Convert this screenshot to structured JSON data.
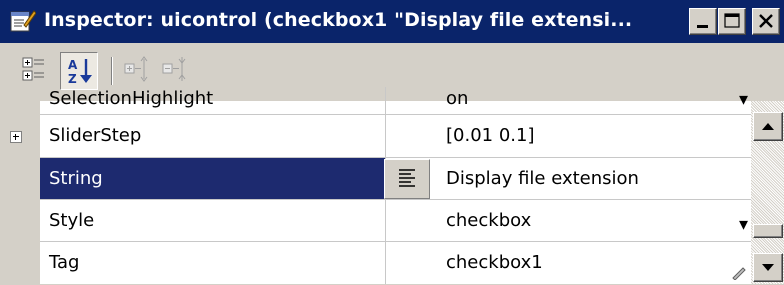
{
  "window": {
    "title": "Inspector:  uicontrol (checkbox1 \"Display file extensi...",
    "title_bg": "#0a246a"
  },
  "toolbar": {
    "buttons": [
      "categorized-view-icon",
      "alphabetical-sort-icon",
      "expand-all-icon",
      "collapse-all-icon"
    ]
  },
  "properties": {
    "rows": [
      {
        "name": "SelectionHighlight",
        "value": "on"
      },
      {
        "name": "SliderStep",
        "value": "[0.01 0.1]"
      },
      {
        "name": "String",
        "value": "Display file extension"
      },
      {
        "name": "Style",
        "value": "checkbox"
      },
      {
        "name": "Tag",
        "value": "checkbox1"
      }
    ],
    "selected": "String",
    "selection_color": "#1d2a6f"
  }
}
